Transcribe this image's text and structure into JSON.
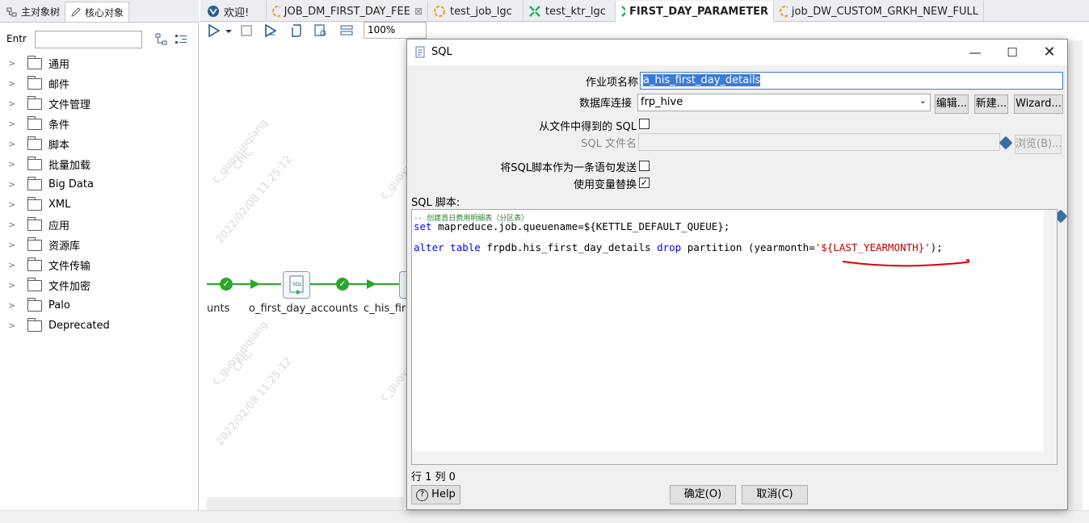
{
  "left_panel": {
    "tabs": [
      {
        "label": "主对象树",
        "icon": "tree-icon"
      },
      {
        "label": "核心对象",
        "icon": "pencil-icon"
      }
    ],
    "entry_label": "Entr",
    "entry_value": "",
    "tree": [
      "通用",
      "邮件",
      "文件管理",
      "条件",
      "脚本",
      "批量加载",
      "Big Data",
      "XML",
      "应用",
      "资源库",
      "文件传输",
      "文件加密",
      "Palo",
      "Deprecated"
    ]
  },
  "editor_tabs": [
    {
      "label": "欢迎!",
      "icon": "welcome-icon"
    },
    {
      "label": "JOB_DM_FIRST_DAY_FEE",
      "icon": "job-icon",
      "close": "⊠"
    },
    {
      "label": "test_job_lgc",
      "icon": "job-icon"
    },
    {
      "label": "test_ktr_lgc",
      "icon": "transformation-icon"
    },
    {
      "label": "FIRST_DAY_PARAMETER",
      "icon": "transformation-icon"
    },
    {
      "label": "job_DW_CUSTOM_GRKH_NEW_FULL",
      "icon": "job-icon"
    }
  ],
  "toolbar": {
    "zoom": "100%"
  },
  "canvas": {
    "steps": [
      "unts",
      "o_first_day_accounts",
      "c_his_first"
    ],
    "watermark_user": "c_guoyunqiang",
    "watermark_org": "CPIC",
    "watermark_time": "2022/02/08 11:25:12"
  },
  "dialog": {
    "title": "SQL",
    "fields": {
      "job_name_label": "作业项名称",
      "job_name_value": "a_his_first_day_details",
      "db_conn_label": "数据库连接",
      "db_conn_value": "frp_hive",
      "edit_btn": "编辑...",
      "new_btn": "新建...",
      "wizard_btn": "Wizard...",
      "sql_from_file_label": "从文件中得到的 SQL",
      "sql_from_file_checked": false,
      "sql_filename_label": "SQL 文件名",
      "sql_filename_value": "",
      "browse_btn": "浏览(B)...",
      "single_statement_label": "将SQL脚本作为一条语句发送",
      "single_statement_checked": false,
      "use_var_label": "使用变量替换",
      "use_var_checked": true
    },
    "script_label": "SQL 脚本:",
    "script": {
      "comment": "-- 创建首日费用明细表（分区表）",
      "line1_kw": "set",
      "line1_rest": " mapreduce.job.queuename=${KETTLE_DEFAULT_QUEUE};",
      "line2_kw1": "alter",
      "line2_sp1": " ",
      "line2_kw2": "table",
      "line2_mid": " frpdb.his_first_day_details ",
      "line2_kw3": "drop",
      "line2_rest": " partition (yearmonth=",
      "line2_str": "'${LAST_YEARMONTH}'",
      "line2_end": ");"
    },
    "cursor_pos": "行 1 列 0",
    "help_btn": "Help",
    "ok_btn": "确定(O)",
    "cancel_btn": "取消(C)",
    "annotation_color": "#e00000"
  }
}
